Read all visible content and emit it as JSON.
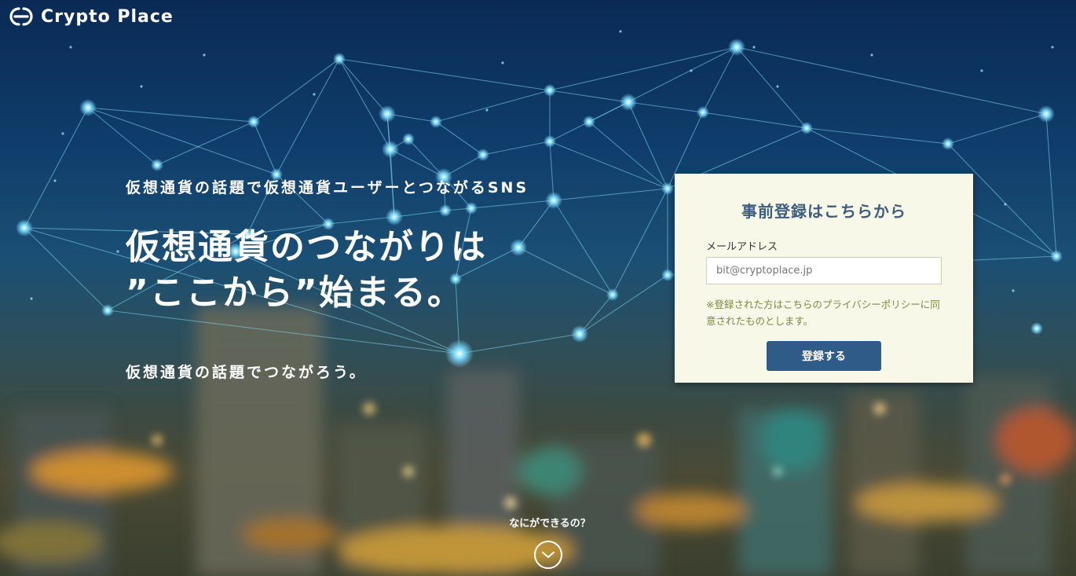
{
  "brand": {
    "name": "Crypto Place",
    "logo_icon": "crypto-place-logo-icon"
  },
  "hero": {
    "tagline": "仮想通貨の話題で仮想通貨ユーザーとつながるSNS",
    "headline_line1": "仮想通貨のつながりは",
    "headline_line2": "”ここから”始まる。",
    "subline": "仮想通貨の話題でつながろう。"
  },
  "register": {
    "title": "事前登録はこちらから",
    "email_label": "メールアドレス",
    "email_placeholder": "bit@cryptoplace.jp",
    "policy_note": "※登録された方はこちらのプライバシーポリシーに同意されたものとします。",
    "submit_label": "登録する"
  },
  "scroll": {
    "hint": "なにができるの？",
    "icon": "chevron-down-icon"
  },
  "colors": {
    "card_background": "#f7f8e8",
    "card_title": "#3c5d7f",
    "button": "#2e5b87",
    "policy_text": "#7d8a3e",
    "network_node": "#7fdcff"
  }
}
